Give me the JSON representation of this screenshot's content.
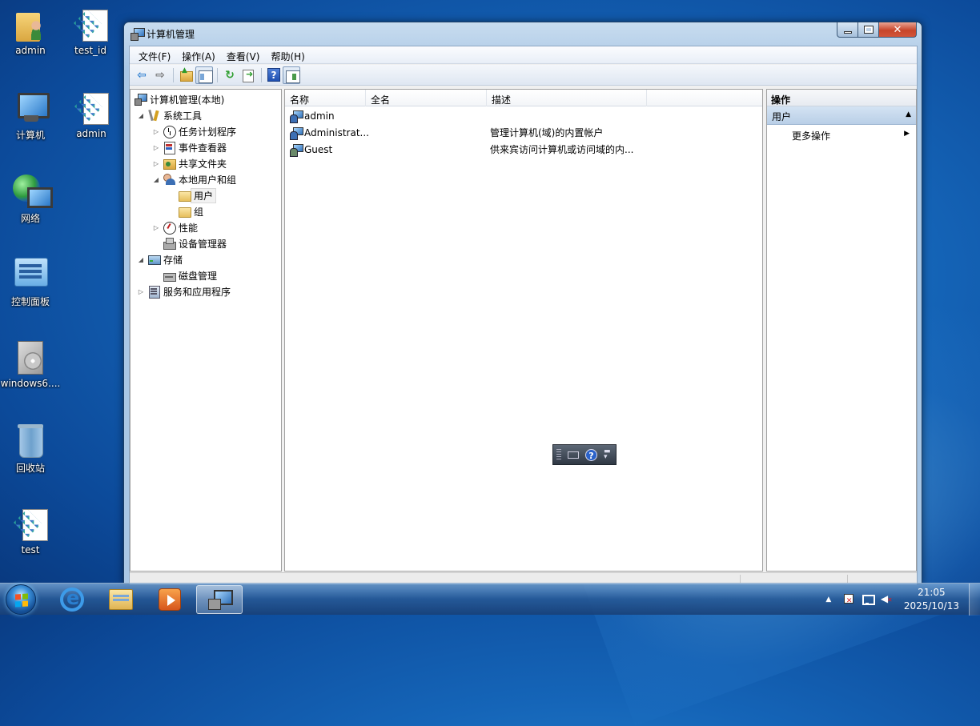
{
  "desktop": {
    "icons": [
      {
        "label": "admin"
      },
      {
        "label": "test_id"
      },
      {
        "label": "计算机"
      },
      {
        "label": "admin"
      },
      {
        "label": "网络"
      },
      {
        "label": "控制面板"
      },
      {
        "label": "windows6...."
      },
      {
        "label": "回收站"
      },
      {
        "label": "test"
      }
    ]
  },
  "window": {
    "title": "计算机管理",
    "close_glyph": "✕"
  },
  "menubar": {
    "items": [
      "文件(F)",
      "操作(A)",
      "查看(V)",
      "帮助(H)"
    ]
  },
  "toolbar": {
    "back_glyph": "⇦",
    "forward_glyph": "⇨",
    "refresh_glyph": "↻",
    "help_glyph": "?"
  },
  "tree": {
    "root": "计算机管理(本地)",
    "system_tools": "系统工具",
    "task_scheduler": "任务计划程序",
    "event_viewer": "事件查看器",
    "shared_folders": "共享文件夹",
    "local_users_groups": "本地用户和组",
    "users": "用户",
    "groups": "组",
    "performance": "性能",
    "device_manager": "设备管理器",
    "storage": "存储",
    "disk_management": "磁盘管理",
    "services_apps": "服务和应用程序",
    "expanded_glyph": "◢",
    "collapsed_glyph": "▷"
  },
  "list": {
    "columns": {
      "name": "名称",
      "fullname": "全名",
      "description": "描述"
    },
    "rows": [
      {
        "name": "admin",
        "fullname": "",
        "description": ""
      },
      {
        "name": "Administrat...",
        "fullname": "",
        "description": "管理计算机(域)的内置帐户"
      },
      {
        "name": "Guest",
        "fullname": "",
        "description": "供来宾访问计算机或访问域的内..."
      }
    ]
  },
  "actions": {
    "title": "操作",
    "section": "用户",
    "more_actions": "更多操作",
    "collapse_glyph": "▲",
    "arrow_glyph": "▶"
  },
  "language_bar": {
    "help_glyph": "?"
  },
  "taskbar": {
    "tray_up_glyph": "▲",
    "time": "21:05",
    "date": "2025/10/13"
  }
}
